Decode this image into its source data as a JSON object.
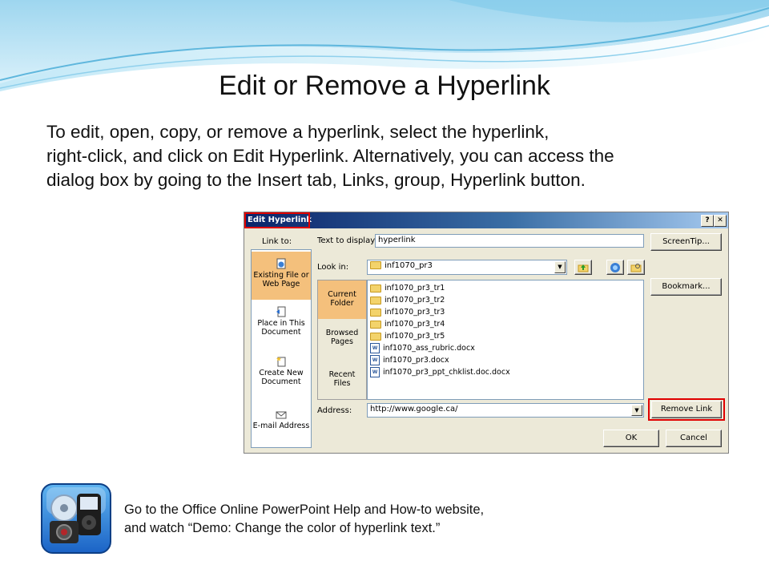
{
  "slide": {
    "title": "Edit or Remove a Hyperlink",
    "body_lines": [
      "To edit, open, copy, or remove a hyperlink, select the hyperlink,",
      "right-click, and click on Edit Hyperlink. Alternatively, you can access the",
      "dialog box by going to the Insert tab, Links, group, Hyperlink button."
    ],
    "footer_lines": [
      "Go to the Office Online PowerPoint Help and How-to website,",
      "and watch “Demo: Change the color of hyperlink text.”"
    ],
    "footer_icon": "media-devices-icon"
  },
  "dialog": {
    "title": "Edit Hyperlink",
    "help_glyph": "?",
    "close_glyph": "✕",
    "link_to_label": "Link to:",
    "link_to_items": [
      {
        "line1": "Existing File or",
        "line2": "Web Page",
        "icon": "globe-file-icon",
        "selected": true
      },
      {
        "line1": "Place in This",
        "line2": "Document",
        "icon": "place-in-document-icon",
        "selected": false
      },
      {
        "line1": "Create New",
        "line2": "Document",
        "icon": "new-document-icon",
        "selected": false
      },
      {
        "line1": "E-mail Address",
        "line2": "",
        "icon": "email-icon",
        "selected": false
      }
    ],
    "text_to_display_label": "Text to display:",
    "text_to_display_value": "hyperlink",
    "screentip_label": "ScreenTip...",
    "look_in_label": "Look in:",
    "look_in_value": "inf1070_pr3",
    "look_in_buttons": [
      "up-folder-icon",
      "browse-web-icon",
      "browse-file-icon"
    ],
    "side_tabs": [
      {
        "line1": "Current",
        "line2": "Folder",
        "selected": true
      },
      {
        "line1": "Browsed",
        "line2": "Pages",
        "selected": false
      },
      {
        "line1": "Recent",
        "line2": "Files",
        "selected": false
      }
    ],
    "files": [
      {
        "name": "inf1070_pr3_tr1",
        "type": "folder"
      },
      {
        "name": "inf1070_pr3_tr2",
        "type": "folder"
      },
      {
        "name": "inf1070_pr3_tr3",
        "type": "folder"
      },
      {
        "name": "inf1070_pr3_tr4",
        "type": "folder"
      },
      {
        "name": "inf1070_pr3_tr5",
        "type": "folder"
      },
      {
        "name": "inf1070_ass_rubric.docx",
        "type": "doc"
      },
      {
        "name": "inf1070_pr3.docx",
        "type": "doc"
      },
      {
        "name": "inf1070_pr3_ppt_chklist.doc.docx",
        "type": "doc"
      }
    ],
    "bookmark_label": "Bookmark...",
    "address_label": "Address:",
    "address_value": "http://www.google.ca/",
    "remove_link_label": "Remove Link",
    "ok_label": "OK",
    "cancel_label": "Cancel",
    "highlight_color": "#e00000"
  }
}
